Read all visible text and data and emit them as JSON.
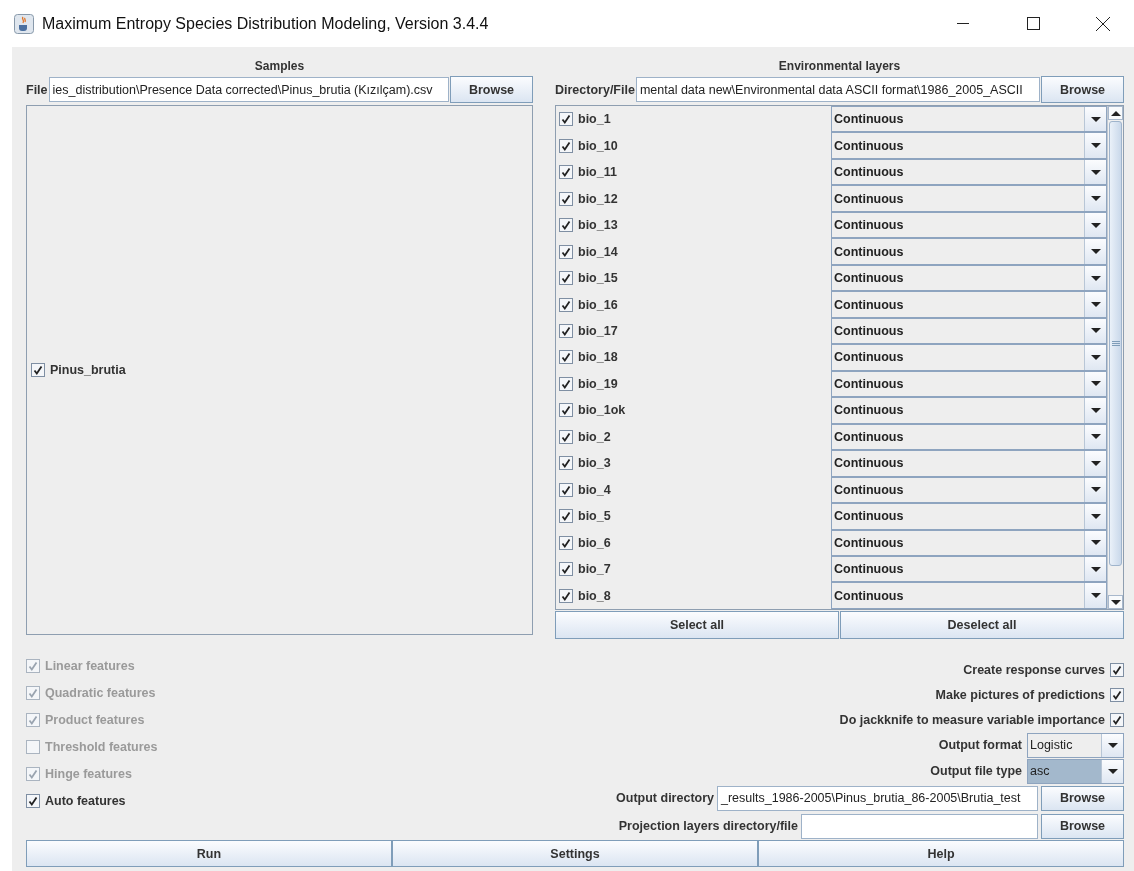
{
  "window": {
    "title": "Maximum Entropy Species Distribution Modeling, Version 3.4.4"
  },
  "samples": {
    "header": "Samples",
    "file_label": "File",
    "file_value": "ies_distribution\\Presence Data corrected\\Pinus_brutia (Kızılçam).csv",
    "browse": "Browse",
    "species": [
      {
        "name": "Pinus_brutia",
        "checked": true
      }
    ]
  },
  "environmental_layers": {
    "header": "Environmental layers",
    "dir_label": "Directory/File",
    "dir_value": "mental data new\\Environmental data ASCII format\\1986_2005_ASCII",
    "browse": "Browse",
    "layers": [
      {
        "name": "bio_1",
        "checked": true,
        "type": "Continuous"
      },
      {
        "name": "bio_10",
        "checked": true,
        "type": "Continuous"
      },
      {
        "name": "bio_11",
        "checked": true,
        "type": "Continuous"
      },
      {
        "name": "bio_12",
        "checked": true,
        "type": "Continuous"
      },
      {
        "name": "bio_13",
        "checked": true,
        "type": "Continuous"
      },
      {
        "name": "bio_14",
        "checked": true,
        "type": "Continuous"
      },
      {
        "name": "bio_15",
        "checked": true,
        "type": "Continuous"
      },
      {
        "name": "bio_16",
        "checked": true,
        "type": "Continuous"
      },
      {
        "name": "bio_17",
        "checked": true,
        "type": "Continuous"
      },
      {
        "name": "bio_18",
        "checked": true,
        "type": "Continuous"
      },
      {
        "name": "bio_19",
        "checked": true,
        "type": "Continuous"
      },
      {
        "name": "bio_1ok",
        "checked": true,
        "type": "Continuous"
      },
      {
        "name": "bio_2",
        "checked": true,
        "type": "Continuous"
      },
      {
        "name": "bio_3",
        "checked": true,
        "type": "Continuous"
      },
      {
        "name": "bio_4",
        "checked": true,
        "type": "Continuous"
      },
      {
        "name": "bio_5",
        "checked": true,
        "type": "Continuous"
      },
      {
        "name": "bio_6",
        "checked": true,
        "type": "Continuous"
      },
      {
        "name": "bio_7",
        "checked": true,
        "type": "Continuous"
      },
      {
        "name": "bio_8",
        "checked": true,
        "type": "Continuous"
      }
    ],
    "select_all": "Select all",
    "deselect_all": "Deselect all"
  },
  "features": [
    {
      "label": "Linear features",
      "checked": true,
      "disabled": true
    },
    {
      "label": "Quadratic features",
      "checked": true,
      "disabled": true
    },
    {
      "label": "Product features",
      "checked": true,
      "disabled": true
    },
    {
      "label": "Threshold features",
      "checked": false,
      "disabled": true
    },
    {
      "label": "Hinge features",
      "checked": true,
      "disabled": true
    },
    {
      "label": "Auto features",
      "checked": true,
      "disabled": false
    }
  ],
  "options": [
    {
      "label": "Create response curves",
      "checked": true
    },
    {
      "label": "Make pictures of predictions",
      "checked": true
    },
    {
      "label": "Do jackknife to measure variable importance",
      "checked": true
    }
  ],
  "selects": [
    {
      "label": "Output format",
      "value": "Logistic",
      "focused": false
    },
    {
      "label": "Output file type",
      "value": "asc",
      "focused": true
    }
  ],
  "paths": [
    {
      "label": "Output directory",
      "value": "_results_1986-2005\\Pinus_brutia_86-2005\\Brutia_test",
      "browse": "Browse"
    },
    {
      "label": "Projection layers directory/file",
      "browse": "Browse"
    }
  ],
  "buttons": [
    "Run",
    "Settings",
    "Help"
  ]
}
